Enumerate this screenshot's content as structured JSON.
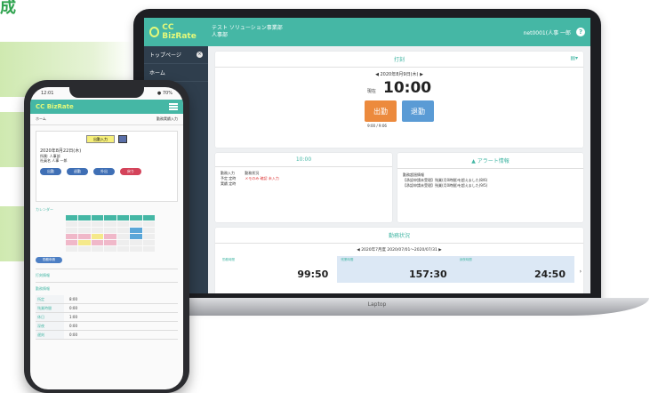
{
  "heading_fragment": "成",
  "laptop": {
    "base_label": "Laptop",
    "header": {
      "logo": "CC BizRate",
      "company_line1": "テスト ソリューション事業部",
      "company_line2": "人事部",
      "user": "net0001(人事 一郎",
      "help": "?"
    },
    "sidebar": {
      "items": [
        "トップページ",
        "ホーム"
      ],
      "close": "×"
    },
    "clock_card": {
      "title": "打刻",
      "date": "2020年8月9日(木)",
      "time_label": "現在",
      "time": "10:00",
      "in_button": "出勤",
      "out_button": "退勤",
      "sub": "9:00 / 9:06",
      "list_icon": "▤▾"
    },
    "schedule_card": {
      "title": "10:00",
      "left_lines": [
        "勤務入力",
        "予定  定時",
        "実績  定時"
      ],
      "right_lines": [
        "勤務状況",
        "メモのみ 確認 未入力"
      ]
    },
    "alert_card": {
      "title": "アラート情報",
      "lines": [
        "勤務超過情報",
        "【承認申請未受理】残業(月0時間)を超えました(8/6)",
        "【承認申請未受理】残業(月0時間)を超えました(9/5)"
      ]
    },
    "summary_card": {
      "title": "勤務状況",
      "period": "2020年7月度 2020/07/01〜2020/07/31",
      "cells": [
        {
          "label": "勤務時間",
          "value": "99:50"
        },
        {
          "label": "残業時間",
          "value": "157:30"
        },
        {
          "label": "深夜時間",
          "value": "24:50"
        }
      ],
      "next": "›"
    }
  },
  "phone": {
    "status_left": "12:01",
    "status_right": "● 70%",
    "logo": "CC BizRate",
    "sub_left": "ホーム",
    "sub_right": "勤務実績入力",
    "yellow_label": "出勤入力",
    "date": "2020年8月22日(木)",
    "info_lines": [
      "所属: 人事部",
      "社員名 人事 一郎"
    ],
    "buttons": [
      {
        "label": "出勤",
        "color": "#3f6fb5"
      },
      {
        "label": "退勤",
        "color": "#3f6fb5"
      },
      {
        "label": "外出",
        "color": "#3f6fb5"
      },
      {
        "label": "戻り",
        "color": "#d4435a"
      }
    ],
    "calendar_title": "カレンダー",
    "pill": "勤務申請",
    "section1": "打刻情報",
    "section2": "勤務情報",
    "table": [
      {
        "k": "所定",
        "v": "8:00"
      },
      {
        "k": "残業時間",
        "v": "0:00"
      },
      {
        "k": "休日",
        "v": "1:00"
      },
      {
        "k": "深夜",
        "v": "0:00"
      },
      {
        "k": "遅刻",
        "v": "0:00"
      }
    ]
  }
}
